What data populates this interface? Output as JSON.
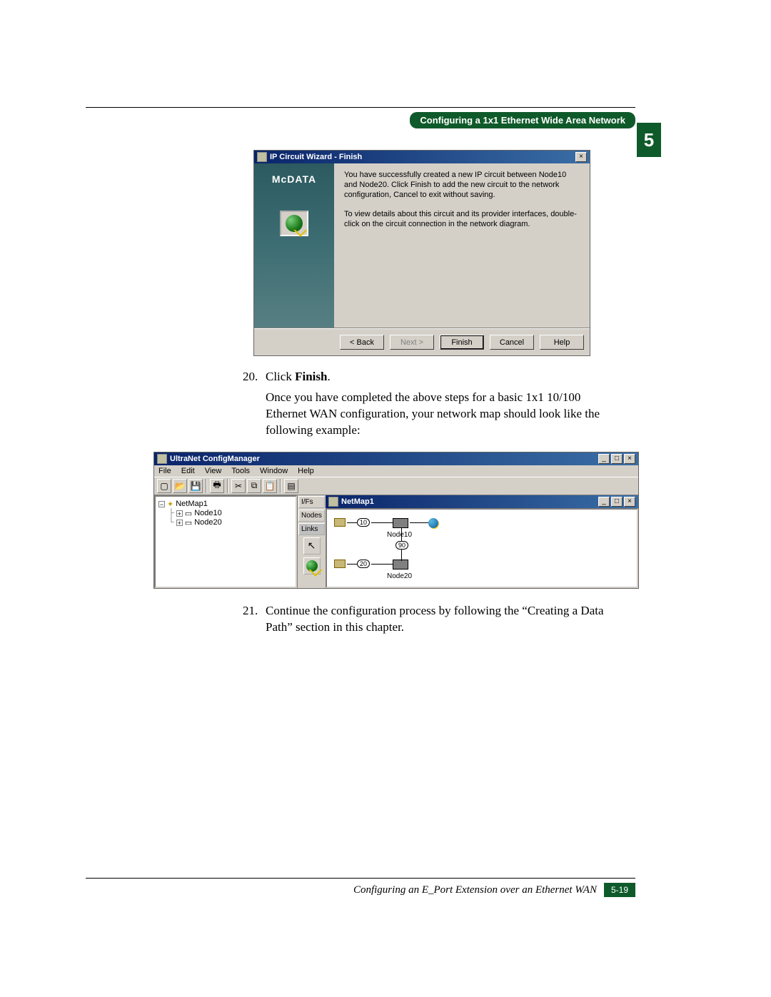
{
  "header": {
    "section_title": "Configuring a 1x1 Ethernet Wide Area Network",
    "chapter_number": "5"
  },
  "wizard": {
    "title": "IP Circuit Wizard - Finish",
    "brand": "McDATA",
    "para1": "You have successfully created a new IP circuit between Node10 and Node20. Click Finish to add the new circuit to the network configuration, Cancel to exit without saving.",
    "para2": "To view details about this circuit and its provider interfaces, double-click on the circuit connection in the network diagram.",
    "buttons": {
      "back": "< Back",
      "next": "Next >",
      "finish": "Finish",
      "cancel": "Cancel",
      "help": "Help"
    }
  },
  "steps": {
    "s20_num": "20.",
    "s20_prefix": "Click ",
    "s20_bold": "Finish",
    "s20_suffix": ".",
    "s20_body": "Once you have completed the above steps for a basic 1x1 10/100 Ethernet WAN configuration, your network map should look like the following example:",
    "s21_num": "21.",
    "s21_body": "Continue the configuration process by following the “Creating a Data Path” section in this chapter."
  },
  "cm": {
    "title": "UltraNet ConfigManager",
    "menus": [
      "File",
      "Edit",
      "View",
      "Tools",
      "Window",
      "Help"
    ],
    "tree": {
      "root": "NetMap1",
      "children": [
        "Node10",
        "Node20"
      ]
    },
    "midtabs": [
      "I/Fs",
      "Nodes",
      "Links"
    ],
    "child_title": "NetMap1",
    "node10": {
      "label": "Node10",
      "port": "10",
      "net": "90"
    },
    "node20": {
      "label": "Node20",
      "port": "20"
    }
  },
  "footer": {
    "doc_title": "Configuring an E_Port Extension over an Ethernet WAN",
    "page": "5-19"
  }
}
